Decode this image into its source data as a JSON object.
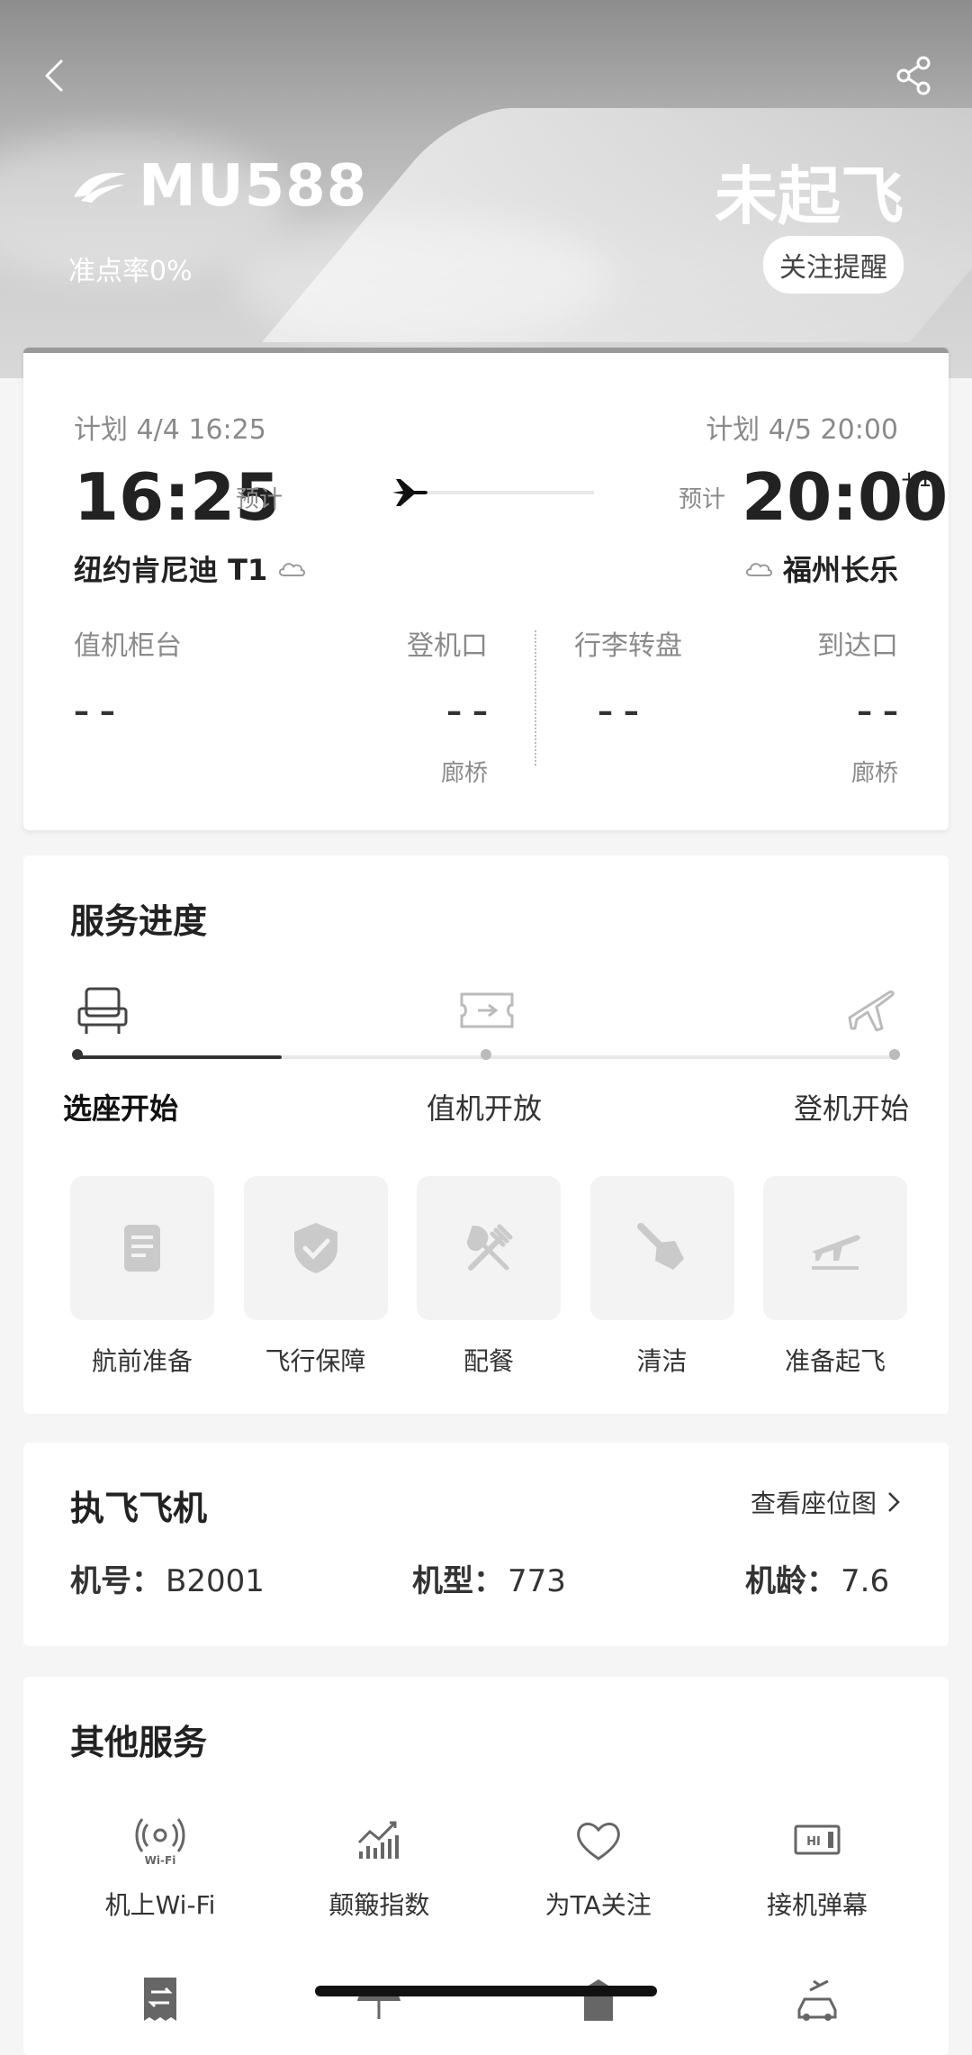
{
  "header": {
    "flight_no": "MU588",
    "status": "未起飞",
    "ontime_rate": "准点率0%",
    "follow_label": "关注提醒"
  },
  "times": {
    "dep_plan": "计划 4/4 16:25",
    "arr_plan": "计划 4/5 20:00",
    "dep_time": "16:25",
    "arr_time": "20:00",
    "plus": "+1",
    "est_label": "预计",
    "dep_city": "纽约肯尼迪 T1",
    "arr_city": "福州长乐"
  },
  "info": {
    "checkin": {
      "label": "值机柜台",
      "value": "– –"
    },
    "gate": {
      "label": "登机口",
      "value": "– –",
      "sub": "廊桥"
    },
    "baggage": {
      "label": "行李转盘",
      "value": "– –"
    },
    "arrival": {
      "label": "到达口",
      "value": "– –",
      "sub": "廊桥"
    }
  },
  "service": {
    "title": "服务进度",
    "progress_fraction": 0.25,
    "steps": [
      "选座开始",
      "值机开放",
      "登机开始"
    ],
    "tiles": [
      "航前准备",
      "飞行保障",
      "配餐",
      "清洁",
      "准备起飞"
    ]
  },
  "aircraft": {
    "title": "执飞飞机",
    "seatmap": "查看座位图",
    "reg_label": "机号：",
    "reg": "B2001",
    "type_label": "机型：",
    "type": "773",
    "age_label": "机龄：",
    "age": "7.6"
  },
  "other": {
    "title": "其他服务",
    "items": [
      "机上Wi-Fi",
      "颠簸指数",
      "为TA关注",
      "接机弹幕"
    ]
  },
  "icons": {
    "back": "chevron-left-icon",
    "share": "share-icon",
    "logo": "airline-logo-icon",
    "plane": "airplane-icon",
    "cloud": "cloud-icon",
    "seat": "seat-icon",
    "ticket": "ticket-icon",
    "takeoff": "plane-takeoff-icon",
    "doc": "document-icon",
    "shield": "shield-check-icon",
    "utensils": "fork-knife-icon",
    "brush": "brush-icon",
    "depart": "departure-icon",
    "wifi": "wifi-icon",
    "bumpy": "turbulence-chart-icon",
    "heart": "heart-icon",
    "screen": "pickup-sign-icon"
  }
}
